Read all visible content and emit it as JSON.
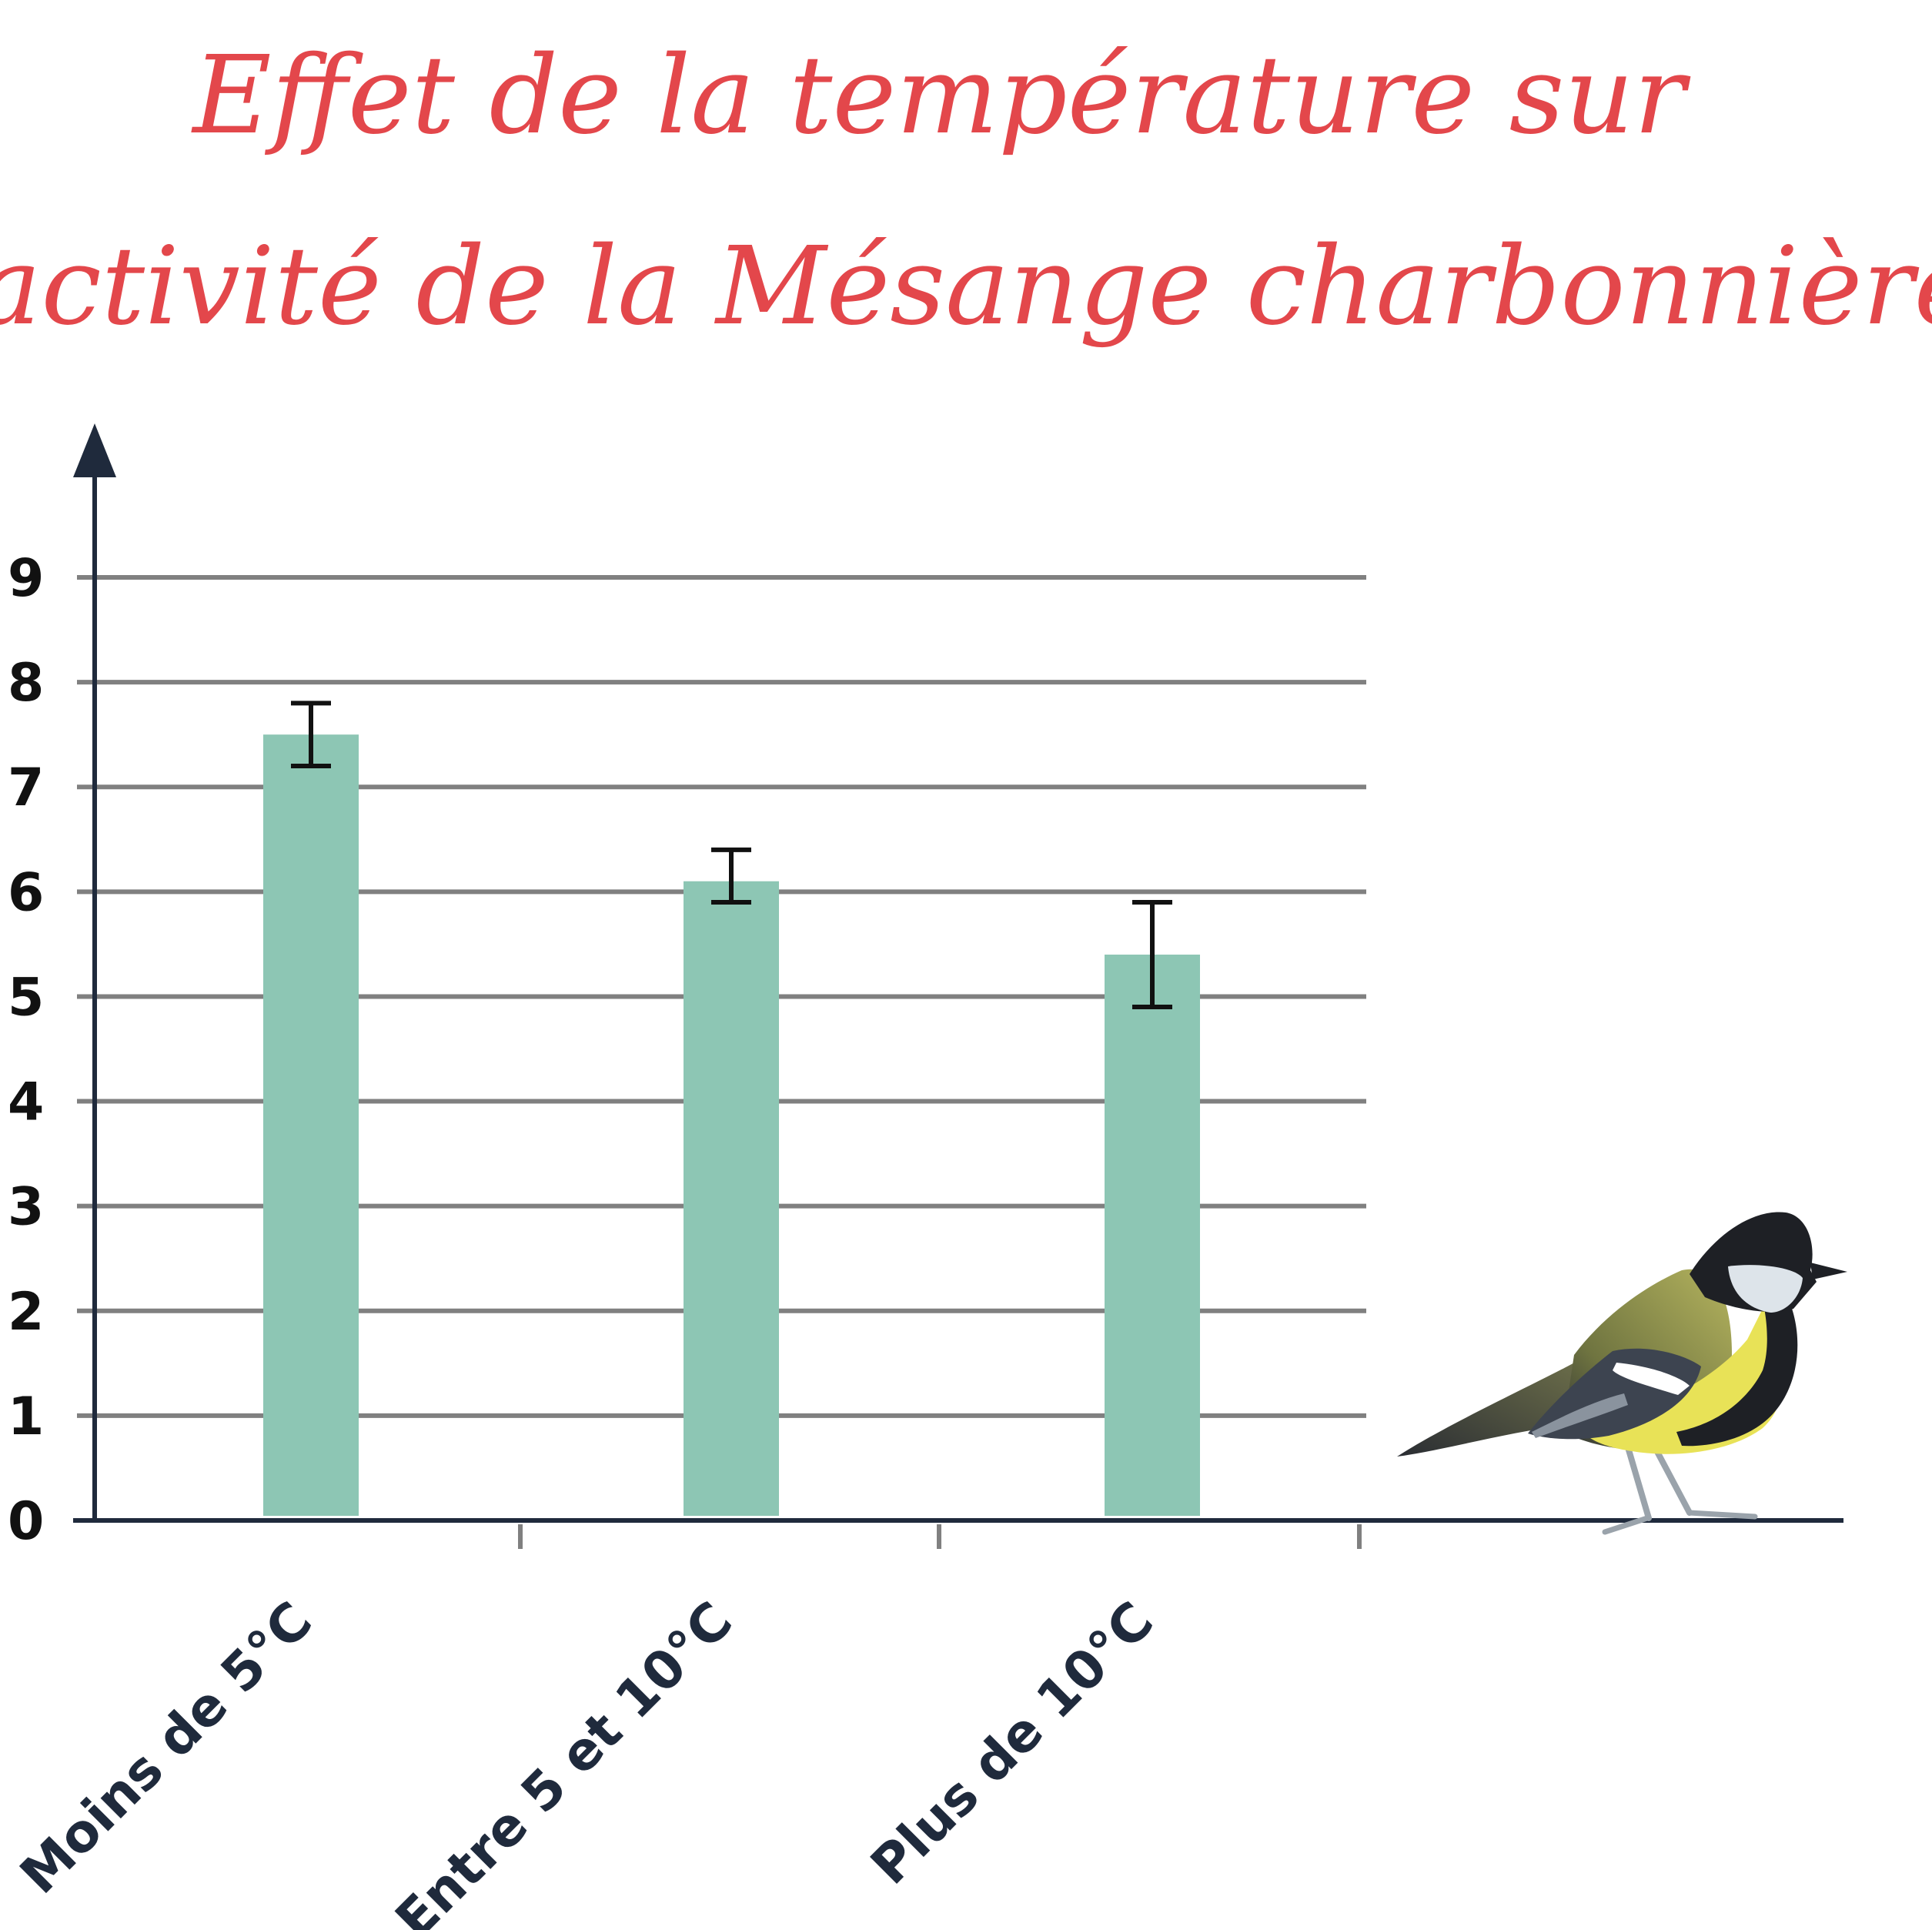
{
  "chart_data": {
    "type": "bar",
    "title_lines": [
      "Effet de la température sur",
      "l’activité de la Mésange charbonnière"
    ],
    "categories": [
      "Moins de 5°C",
      "Entre 5 et 10°C",
      "Plus de 10°C"
    ],
    "values": [
      7.5,
      6.1,
      5.4
    ],
    "error_low": [
      7.2,
      5.9,
      4.9
    ],
    "error_high": [
      7.8,
      6.4,
      5.9
    ],
    "yticks": [
      "0",
      "1",
      "2",
      "3",
      "4",
      "5",
      "6",
      "7",
      "8",
      "9"
    ],
    "ylim": [
      0,
      9
    ],
    "grid": true,
    "colors": {
      "bar": "#8dc6b4",
      "grid": "#808080",
      "axis": "#1f2a3c",
      "error_bar": "#111111",
      "title": "#e3474b"
    }
  }
}
